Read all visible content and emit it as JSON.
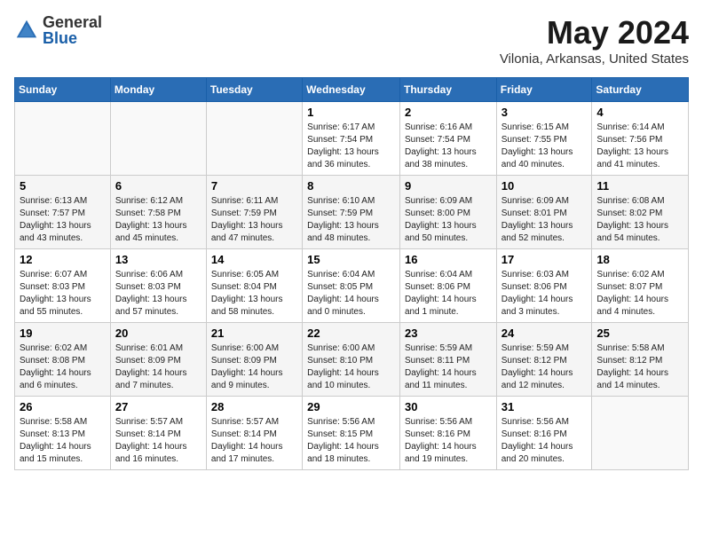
{
  "logo": {
    "general": "General",
    "blue": "Blue"
  },
  "title": "May 2024",
  "location": "Vilonia, Arkansas, United States",
  "days_header": [
    "Sunday",
    "Monday",
    "Tuesday",
    "Wednesday",
    "Thursday",
    "Friday",
    "Saturday"
  ],
  "weeks": [
    [
      {
        "day": "",
        "sunrise": "",
        "sunset": "",
        "daylight": ""
      },
      {
        "day": "",
        "sunrise": "",
        "sunset": "",
        "daylight": ""
      },
      {
        "day": "",
        "sunrise": "",
        "sunset": "",
        "daylight": ""
      },
      {
        "day": "1",
        "sunrise": "Sunrise: 6:17 AM",
        "sunset": "Sunset: 7:54 PM",
        "daylight": "Daylight: 13 hours and 36 minutes."
      },
      {
        "day": "2",
        "sunrise": "Sunrise: 6:16 AM",
        "sunset": "Sunset: 7:54 PM",
        "daylight": "Daylight: 13 hours and 38 minutes."
      },
      {
        "day": "3",
        "sunrise": "Sunrise: 6:15 AM",
        "sunset": "Sunset: 7:55 PM",
        "daylight": "Daylight: 13 hours and 40 minutes."
      },
      {
        "day": "4",
        "sunrise": "Sunrise: 6:14 AM",
        "sunset": "Sunset: 7:56 PM",
        "daylight": "Daylight: 13 hours and 41 minutes."
      }
    ],
    [
      {
        "day": "5",
        "sunrise": "Sunrise: 6:13 AM",
        "sunset": "Sunset: 7:57 PM",
        "daylight": "Daylight: 13 hours and 43 minutes."
      },
      {
        "day": "6",
        "sunrise": "Sunrise: 6:12 AM",
        "sunset": "Sunset: 7:58 PM",
        "daylight": "Daylight: 13 hours and 45 minutes."
      },
      {
        "day": "7",
        "sunrise": "Sunrise: 6:11 AM",
        "sunset": "Sunset: 7:59 PM",
        "daylight": "Daylight: 13 hours and 47 minutes."
      },
      {
        "day": "8",
        "sunrise": "Sunrise: 6:10 AM",
        "sunset": "Sunset: 7:59 PM",
        "daylight": "Daylight: 13 hours and 48 minutes."
      },
      {
        "day": "9",
        "sunrise": "Sunrise: 6:09 AM",
        "sunset": "Sunset: 8:00 PM",
        "daylight": "Daylight: 13 hours and 50 minutes."
      },
      {
        "day": "10",
        "sunrise": "Sunrise: 6:09 AM",
        "sunset": "Sunset: 8:01 PM",
        "daylight": "Daylight: 13 hours and 52 minutes."
      },
      {
        "day": "11",
        "sunrise": "Sunrise: 6:08 AM",
        "sunset": "Sunset: 8:02 PM",
        "daylight": "Daylight: 13 hours and 54 minutes."
      }
    ],
    [
      {
        "day": "12",
        "sunrise": "Sunrise: 6:07 AM",
        "sunset": "Sunset: 8:03 PM",
        "daylight": "Daylight: 13 hours and 55 minutes."
      },
      {
        "day": "13",
        "sunrise": "Sunrise: 6:06 AM",
        "sunset": "Sunset: 8:03 PM",
        "daylight": "Daylight: 13 hours and 57 minutes."
      },
      {
        "day": "14",
        "sunrise": "Sunrise: 6:05 AM",
        "sunset": "Sunset: 8:04 PM",
        "daylight": "Daylight: 13 hours and 58 minutes."
      },
      {
        "day": "15",
        "sunrise": "Sunrise: 6:04 AM",
        "sunset": "Sunset: 8:05 PM",
        "daylight": "Daylight: 14 hours and 0 minutes."
      },
      {
        "day": "16",
        "sunrise": "Sunrise: 6:04 AM",
        "sunset": "Sunset: 8:06 PM",
        "daylight": "Daylight: 14 hours and 1 minute."
      },
      {
        "day": "17",
        "sunrise": "Sunrise: 6:03 AM",
        "sunset": "Sunset: 8:06 PM",
        "daylight": "Daylight: 14 hours and 3 minutes."
      },
      {
        "day": "18",
        "sunrise": "Sunrise: 6:02 AM",
        "sunset": "Sunset: 8:07 PM",
        "daylight": "Daylight: 14 hours and 4 minutes."
      }
    ],
    [
      {
        "day": "19",
        "sunrise": "Sunrise: 6:02 AM",
        "sunset": "Sunset: 8:08 PM",
        "daylight": "Daylight: 14 hours and 6 minutes."
      },
      {
        "day": "20",
        "sunrise": "Sunrise: 6:01 AM",
        "sunset": "Sunset: 8:09 PM",
        "daylight": "Daylight: 14 hours and 7 minutes."
      },
      {
        "day": "21",
        "sunrise": "Sunrise: 6:00 AM",
        "sunset": "Sunset: 8:09 PM",
        "daylight": "Daylight: 14 hours and 9 minutes."
      },
      {
        "day": "22",
        "sunrise": "Sunrise: 6:00 AM",
        "sunset": "Sunset: 8:10 PM",
        "daylight": "Daylight: 14 hours and 10 minutes."
      },
      {
        "day": "23",
        "sunrise": "Sunrise: 5:59 AM",
        "sunset": "Sunset: 8:11 PM",
        "daylight": "Daylight: 14 hours and 11 minutes."
      },
      {
        "day": "24",
        "sunrise": "Sunrise: 5:59 AM",
        "sunset": "Sunset: 8:12 PM",
        "daylight": "Daylight: 14 hours and 12 minutes."
      },
      {
        "day": "25",
        "sunrise": "Sunrise: 5:58 AM",
        "sunset": "Sunset: 8:12 PM",
        "daylight": "Daylight: 14 hours and 14 minutes."
      }
    ],
    [
      {
        "day": "26",
        "sunrise": "Sunrise: 5:58 AM",
        "sunset": "Sunset: 8:13 PM",
        "daylight": "Daylight: 14 hours and 15 minutes."
      },
      {
        "day": "27",
        "sunrise": "Sunrise: 5:57 AM",
        "sunset": "Sunset: 8:14 PM",
        "daylight": "Daylight: 14 hours and 16 minutes."
      },
      {
        "day": "28",
        "sunrise": "Sunrise: 5:57 AM",
        "sunset": "Sunset: 8:14 PM",
        "daylight": "Daylight: 14 hours and 17 minutes."
      },
      {
        "day": "29",
        "sunrise": "Sunrise: 5:56 AM",
        "sunset": "Sunset: 8:15 PM",
        "daylight": "Daylight: 14 hours and 18 minutes."
      },
      {
        "day": "30",
        "sunrise": "Sunrise: 5:56 AM",
        "sunset": "Sunset: 8:16 PM",
        "daylight": "Daylight: 14 hours and 19 minutes."
      },
      {
        "day": "31",
        "sunrise": "Sunrise: 5:56 AM",
        "sunset": "Sunset: 8:16 PM",
        "daylight": "Daylight: 14 hours and 20 minutes."
      },
      {
        "day": "",
        "sunrise": "",
        "sunset": "",
        "daylight": ""
      }
    ]
  ]
}
